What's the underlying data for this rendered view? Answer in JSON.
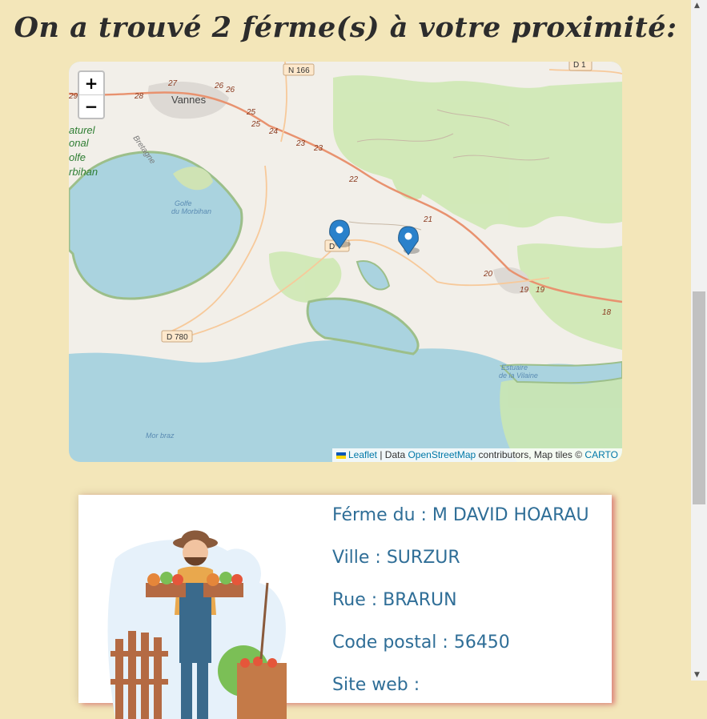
{
  "title": "On a trouvé 2 férme(s) à votre proximité:",
  "map": {
    "zoom_in": "+",
    "zoom_out": "−",
    "attribution": {
      "leaflet": "Leaflet",
      "sep": " | Data ",
      "osm": "OpenStreetMap",
      "contrib": " contributors, Map tiles © ",
      "carto": "CARTO"
    },
    "labels": {
      "vannes": "Vannes",
      "n166": "N 166",
      "d1": "D 1",
      "d780": "D 780",
      "d_mid": "D",
      "golfe": "Golfe",
      "du_morbihan": "du Morbihan",
      "morbraz": "Mor braz",
      "estuaire": "Estuaire",
      "vilaine": "de la Vilaine",
      "bretagne": "Bretagne",
      "naturel": "aturel",
      "onal": "onal",
      "olfe": "olfe",
      "rbihan": "rbihan",
      "km": [
        "27",
        "26",
        "26",
        "28",
        "29",
        "25",
        "25",
        "24",
        "23",
        "23",
        "22",
        "21",
        "20",
        "19",
        "19",
        "18"
      ]
    },
    "marker_count": 2
  },
  "farm": {
    "name_label": "Férme du : M DAVID HOARAU",
    "city_label": "Ville : SURZUR",
    "street_label": "Rue : BRARUN",
    "postal_label": "Code postal : 56450",
    "site_label": "Site web :"
  },
  "colors": {
    "background": "#f3e6b9",
    "card_text": "#2f6e97",
    "water": "#aad3df",
    "land": "#f2efe9",
    "road": "#f08f6b",
    "marker": "#2a81cb"
  }
}
